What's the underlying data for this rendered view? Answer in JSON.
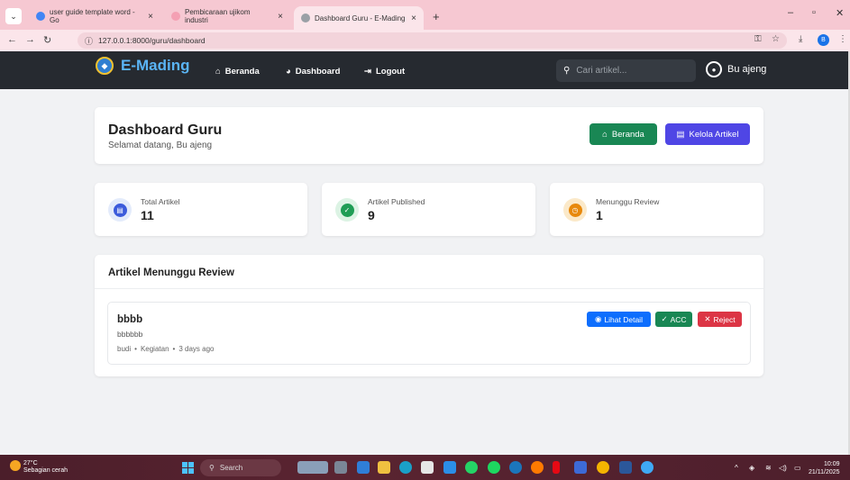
{
  "browser": {
    "tabs": [
      {
        "label": "user guide template word - Go",
        "favicon_color": "#4285f4"
      },
      {
        "label": "Pembicaraan ujikom industri",
        "favicon_color": "#f4a0b3"
      },
      {
        "label": "Dashboard Guru - E-Mading",
        "favicon_color": "#9aa0a6"
      }
    ],
    "new_tab": "+",
    "url": "127.0.0.1:8000/guru/dashboard",
    "profile_initial": "B"
  },
  "navbar": {
    "brand": "E-Mading",
    "links": {
      "beranda": "Beranda",
      "dashboard": "Dashboard",
      "logout": "Logout"
    },
    "search_placeholder": "Cari artikel...",
    "user": "Bu ajeng"
  },
  "header": {
    "title": "Dashboard Guru",
    "subtitle": "Selamat datang, Bu ajeng",
    "btn_beranda": "Beranda",
    "btn_kelola": "Kelola Artikel"
  },
  "stats": [
    {
      "label": "Total Artikel",
      "value": "11",
      "color": "#3b5bdb",
      "bg": "#e3ebfb"
    },
    {
      "label": "Artikel Published",
      "value": "9",
      "color": "#1f9d55",
      "bg": "#dcf3e4"
    },
    {
      "label": "Menunggu Review",
      "value": "1",
      "color": "#e8890c",
      "bg": "#fbe9c9"
    }
  ],
  "review": {
    "title": "Artikel Menunggu Review",
    "items": [
      {
        "title": "bbbb",
        "body": "bbbbbb",
        "author": "budi",
        "category": "Kegiatan",
        "time": "3 days ago",
        "sep": "•",
        "btn_detail": "Lihat Detail",
        "btn_acc": "ACC",
        "btn_reject": "Reject"
      }
    ]
  },
  "taskbar": {
    "temp": "27°C",
    "weather": "Sebagian cerah",
    "search": "Search",
    "time": "10:09",
    "date": "21/11/2025"
  },
  "colors": {
    "navbar": "#262a30",
    "green": "#198754",
    "indigo": "#4f46e5",
    "blue": "#0d6efd",
    "red": "#dc3545"
  }
}
